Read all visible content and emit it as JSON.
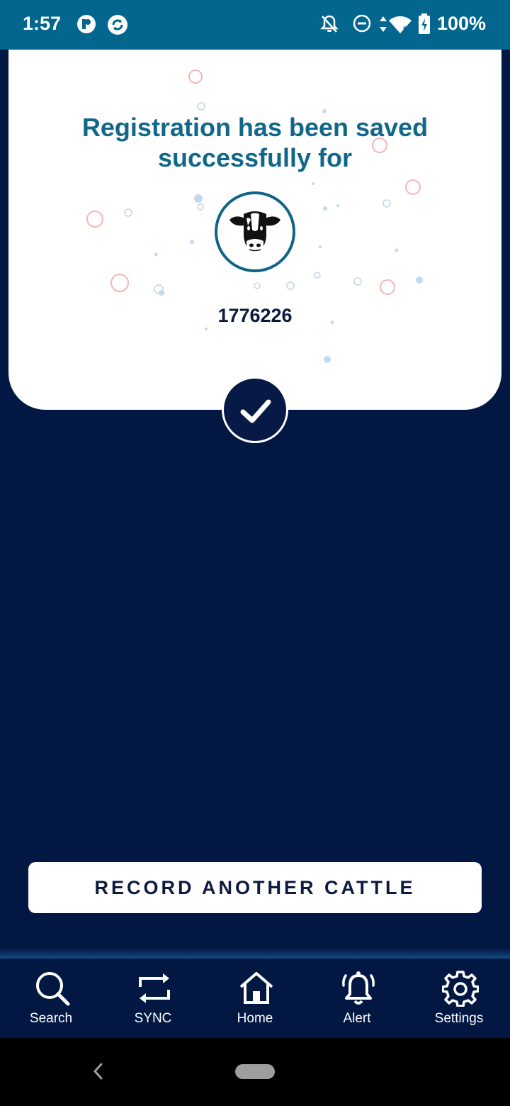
{
  "status_bar": {
    "time": "1:57",
    "battery": "100%",
    "icons": [
      "app-p-icon",
      "app-refresh-icon",
      "notifications-off-icon",
      "do-not-disturb-icon",
      "data-arrows-icon",
      "wifi-icon",
      "battery-charging-icon"
    ]
  },
  "card": {
    "title_line1": "Registration has been saved",
    "title_line2": "successfully for",
    "tag_number": "1776226",
    "animal_icon": "cow-head-icon",
    "background_color": "#ffffff",
    "title_color": "#116789"
  },
  "actions": {
    "record_another": "RECORD ANOTHER CATTLE"
  },
  "bottom_nav": {
    "items": [
      {
        "label": "Search",
        "icon": "search-icon"
      },
      {
        "label": "SYNC",
        "icon": "sync-icon"
      },
      {
        "label": "Home",
        "icon": "home-icon"
      },
      {
        "label": "Alert",
        "icon": "bell-icon"
      },
      {
        "label": "Settings",
        "icon": "gear-icon"
      }
    ]
  },
  "colors": {
    "status_bar": "#03668f",
    "background": "#021843",
    "accent": "#116789"
  }
}
